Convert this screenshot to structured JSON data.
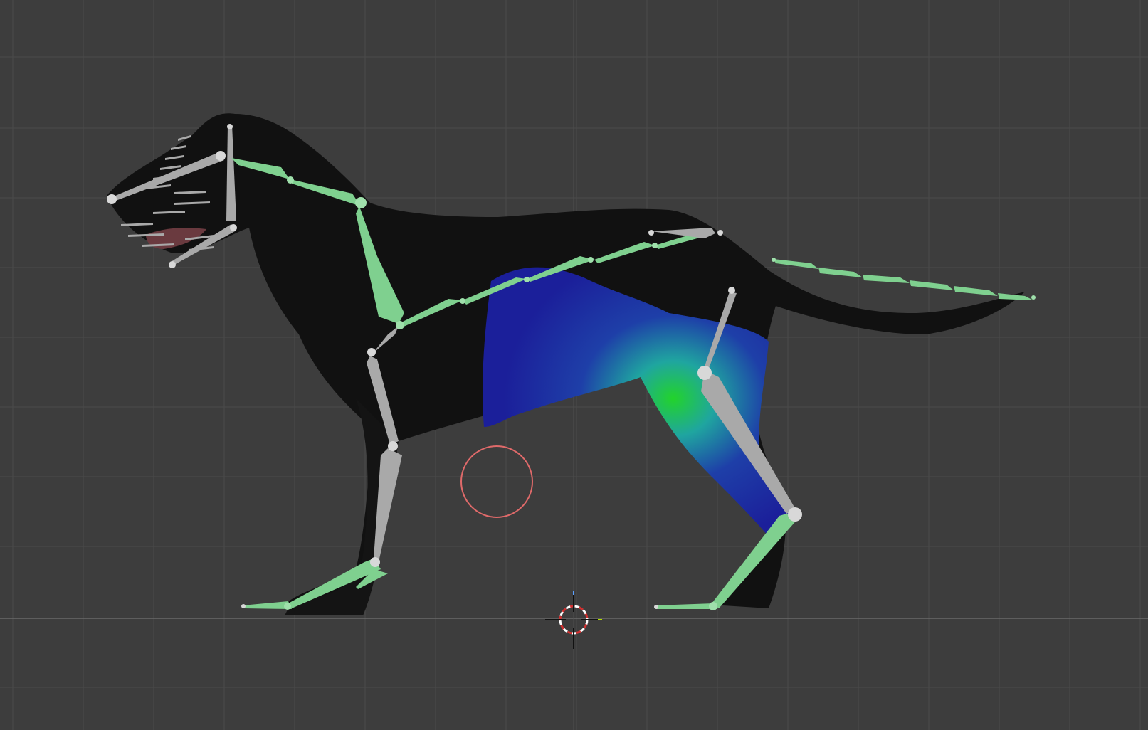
{
  "viewport": {
    "mode": "weight-paint",
    "view": "side",
    "background_color": "#3d3d3d",
    "grid_color": "#4a4a4a",
    "axis_line_color": "#6a6a6a"
  },
  "scene": {
    "model": "dog",
    "body_color": "#111111",
    "weight_gradient": [
      "#1b1f9a",
      "#1e3fa8",
      "#1fa5a0",
      "#22d32b"
    ],
    "bone_colors": {
      "selected_chain": "#7fd08f",
      "deform": "#a9a9a9",
      "joint": "#d8d8d8"
    }
  },
  "icons": {
    "brush_cursor": "brush-cursor-icon",
    "cursor_3d": "3d-cursor-icon"
  }
}
